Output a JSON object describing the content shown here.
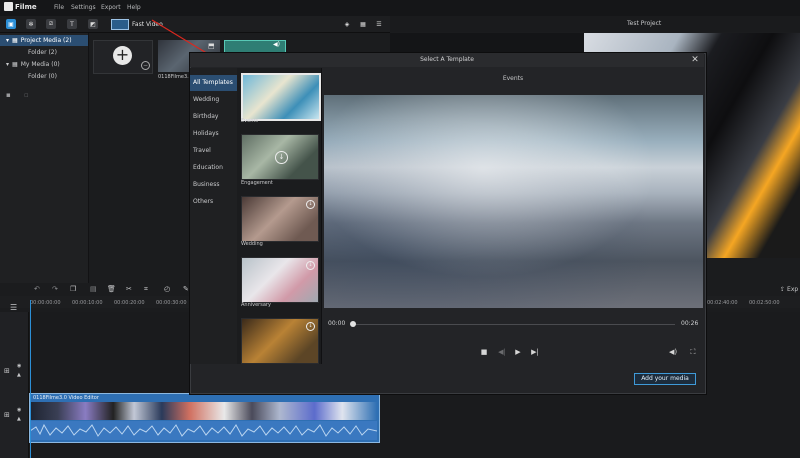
{
  "app": {
    "name": "Filme"
  },
  "menu": [
    "File",
    "Settings",
    "Export",
    "Help"
  ],
  "toolbar": {
    "fast_video_label": "Fast Video"
  },
  "preview": {
    "title": "Test Project"
  },
  "sidebar": {
    "items": [
      {
        "label": "Project Media (2)"
      },
      {
        "label": "Folder (2)"
      },
      {
        "label": "My Media (0)"
      },
      {
        "label": "Folder (0)"
      }
    ]
  },
  "media": {
    "file1_name": "0118Filme3.0"
  },
  "dialog": {
    "title": "Select A Template",
    "close_label": "✕",
    "categories": [
      "All Templates",
      "Wedding",
      "Birthday",
      "Holidays",
      "Travel",
      "Education",
      "Business",
      "Others"
    ],
    "templates": [
      {
        "label": "Events"
      },
      {
        "label": "Engagement"
      },
      {
        "label": "Wedding"
      },
      {
        "label": "Anniversary"
      },
      {
        "label": ""
      }
    ],
    "preview_title": "Events",
    "time_current": "00:00",
    "time_total": "00:26",
    "add_media_label": "Add your media"
  },
  "timeline": {
    "ruler": [
      "00:00:00:00",
      "00:00:10:00",
      "00:00:20:00",
      "00:00:30:00"
    ],
    "ruler_right": [
      "00:02:40:00",
      "00:02:50:00"
    ],
    "export_label": "Exp",
    "clip_label": "0118Filme3.0 Video Editor"
  },
  "colors": {
    "accent": "#2c8fd6",
    "selection": "#2b4e72"
  }
}
